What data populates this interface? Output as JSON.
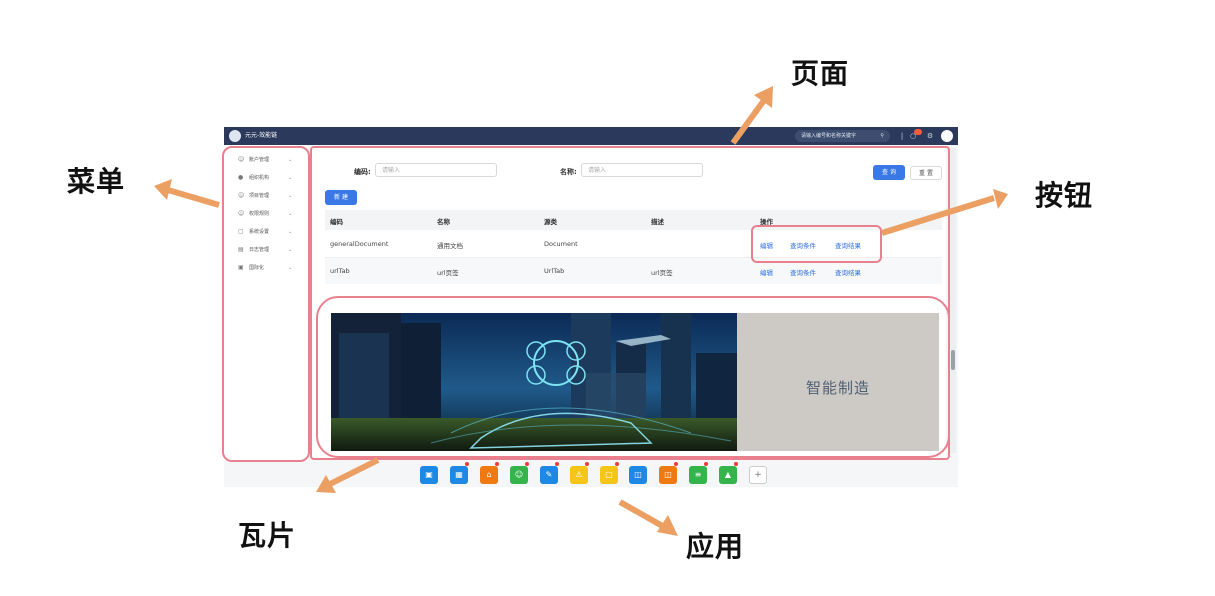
{
  "annotations": {
    "page": "页面",
    "menu": "菜单",
    "button": "按钮",
    "tile": "瓦片",
    "app": "应用"
  },
  "topbar": {
    "title": "元元-效能链",
    "search_placeholder": "请输入编号和名称关键字",
    "search_icon": "search-icon",
    "icons": [
      "divider",
      "bell-icon",
      "gear-icon",
      "avatar"
    ]
  },
  "sidebar": {
    "items": [
      {
        "label": "账户管理",
        "icon": "user-icon"
      },
      {
        "label": "组织机构",
        "icon": "person-icon"
      },
      {
        "label": "项目管理",
        "icon": "person-outline-icon"
      },
      {
        "label": "权限规则",
        "icon": "person-outline-icon"
      },
      {
        "label": "系统设置",
        "icon": "settings-icon"
      },
      {
        "label": "日志管理",
        "icon": "log-icon"
      },
      {
        "label": "国际化",
        "icon": "globe-icon"
      }
    ]
  },
  "filter": {
    "code_label": "编码:",
    "code_placeholder": "请输入",
    "name_label": "名称:",
    "name_placeholder": "请输入",
    "query_button": "查 询",
    "reset_button": "重 置",
    "new_button": "新 建"
  },
  "table": {
    "headers": [
      "编码",
      "名称",
      "源类",
      "描述",
      "操作"
    ],
    "rows": [
      {
        "code": "generalDocument",
        "name": "通用文档",
        "source": "Document",
        "desc": "",
        "actions": [
          "编辑",
          "查询条件",
          "查询结果"
        ]
      },
      {
        "code": "urlTab",
        "name": "url页签",
        "source": "UrlTab",
        "desc": "url页签",
        "actions": [
          "编辑",
          "查询条件",
          "查询结果"
        ]
      }
    ]
  },
  "banner": {
    "text": "智能制造"
  },
  "dock": {
    "apps": [
      {
        "icon": "monitor-icon",
        "color": "#1e88e5",
        "badge": false
      },
      {
        "icon": "grid-icon",
        "color": "#1e88e5",
        "badge": true
      },
      {
        "icon": "home-icon",
        "color": "#f07a12",
        "badge": true
      },
      {
        "icon": "person-icon",
        "color": "#34b44a",
        "badge": true
      },
      {
        "icon": "edit-icon",
        "color": "#1e88e5",
        "badge": true
      },
      {
        "icon": "warning-icon",
        "color": "#f5c518",
        "badge": true
      },
      {
        "icon": "chat-icon",
        "color": "#f5c518",
        "badge": true
      },
      {
        "icon": "database-icon",
        "color": "#1e88e5",
        "badge": false
      },
      {
        "icon": "database-icon",
        "color": "#f07a12",
        "badge": true
      },
      {
        "icon": "list-icon",
        "color": "#34b44a",
        "badge": true
      },
      {
        "icon": "org-icon",
        "color": "#34b44a",
        "badge": true
      }
    ],
    "add_label": "+"
  },
  "colors": {
    "topbar": "#2b3a5c",
    "primary": "#3a78e6",
    "annotation_outline": "#e8808e",
    "arrow": "#eb9f63"
  }
}
